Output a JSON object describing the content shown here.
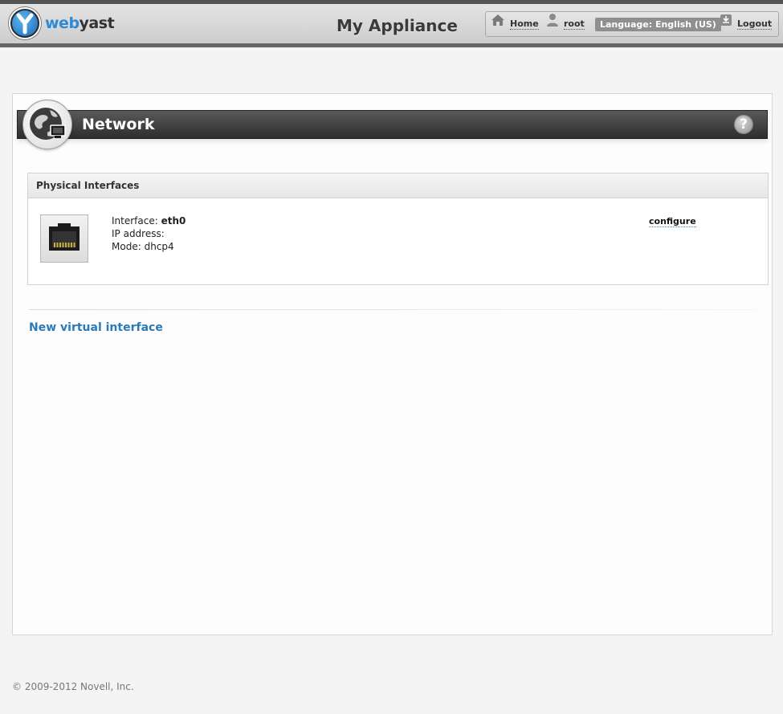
{
  "app": {
    "logo_web": "web",
    "logo_yast": "yast",
    "title": "My Appliance"
  },
  "topnav": {
    "home_label": "Home",
    "user_label": "root",
    "language_label": "Language: English (US)",
    "logout_label": "Logout"
  },
  "page": {
    "title": "Network",
    "help_label": "?"
  },
  "physical_interfaces": {
    "header": "Physical Interfaces",
    "interfaces": [
      {
        "interface_label": "Interface:",
        "interface_value": "eth0",
        "ip_label": "IP address:",
        "ip_value": "",
        "mode_label": "Mode:",
        "mode_value": "dhcp4",
        "action_label": "configure"
      }
    ]
  },
  "actions": {
    "new_virtual_label": "New virtual interface"
  },
  "footer": {
    "copyright": "© 2009-2012 Novell, Inc."
  },
  "colors": {
    "link_blue": "#2a7ab8",
    "logo_blue": "#2d8ad6",
    "titlebar_dark": "#2d2d2d"
  }
}
